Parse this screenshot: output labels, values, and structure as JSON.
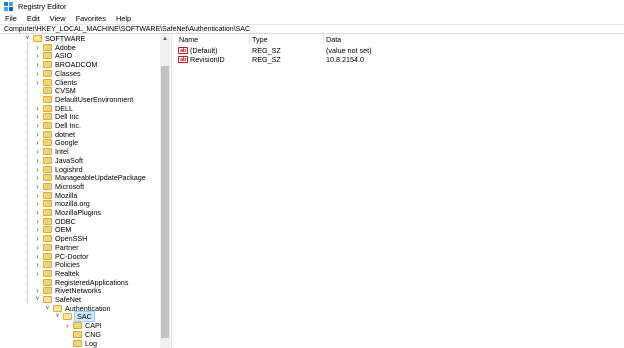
{
  "window": {
    "title": "Registry Editor",
    "icon": "registry-icon"
  },
  "menu": [
    "File",
    "Edit",
    "View",
    "Favorites",
    "Help"
  ],
  "address": "Computer\\HKEY_LOCAL_MACHINE\\SOFTWARE\\SafeNet\\Authentication\\SAC",
  "tree": [
    {
      "label": "SOFTWARE",
      "state": "expanded"
    },
    {
      "label": "Adobe",
      "state": "collapsed"
    },
    {
      "label": "ASIO",
      "state": "collapsed"
    },
    {
      "label": "BROADCOM",
      "state": "collapsed"
    },
    {
      "label": "Classes",
      "state": "collapsed"
    },
    {
      "label": "Clients",
      "state": "collapsed"
    },
    {
      "label": "CVSM",
      "state": "leaf"
    },
    {
      "label": "DefaultUserEnvironment",
      "state": "leaf"
    },
    {
      "label": "DELL",
      "state": "collapsed"
    },
    {
      "label": "Dell Inc",
      "state": "collapsed"
    },
    {
      "label": "Dell Inc.",
      "state": "collapsed"
    },
    {
      "label": "dotnet",
      "state": "collapsed"
    },
    {
      "label": "Google",
      "state": "collapsed"
    },
    {
      "label": "Intel",
      "state": "collapsed"
    },
    {
      "label": "JavaSoft",
      "state": "collapsed"
    },
    {
      "label": "Logishrd",
      "state": "collapsed"
    },
    {
      "label": "ManageableUpdatePackage",
      "state": "collapsed"
    },
    {
      "label": "Microsoft",
      "state": "collapsed"
    },
    {
      "label": "Mozilla",
      "state": "collapsed"
    },
    {
      "label": "mozilla.org",
      "state": "collapsed"
    },
    {
      "label": "MozillaPlugins",
      "state": "collapsed"
    },
    {
      "label": "ODBC",
      "state": "collapsed"
    },
    {
      "label": "OEM",
      "state": "collapsed"
    },
    {
      "label": "OpenSSH",
      "state": "collapsed"
    },
    {
      "label": "Partner",
      "state": "collapsed"
    },
    {
      "label": "PC-Doctor",
      "state": "collapsed"
    },
    {
      "label": "Policies",
      "state": "collapsed"
    },
    {
      "label": "Realtek",
      "state": "collapsed"
    },
    {
      "label": "RegisteredApplications",
      "state": "leaf"
    },
    {
      "label": "RivetNetworks",
      "state": "collapsed"
    },
    {
      "label": "SafeNet",
      "state": "expanded"
    },
    {
      "label": "Authentication",
      "state": "expanded"
    },
    {
      "label": "SAC",
      "state": "expanded",
      "selected": true
    },
    {
      "label": "CAPI",
      "state": "collapsed"
    },
    {
      "label": "CNG",
      "state": "leaf"
    },
    {
      "label": "Log",
      "state": "leaf"
    }
  ],
  "values_table": {
    "columns": [
      "Name",
      "Type",
      "Data"
    ],
    "rows": [
      {
        "name": "(Default)",
        "type": "REG_SZ",
        "data": "(value not set)",
        "icon": "string-value-icon"
      },
      {
        "name": "RevisionID",
        "type": "REG_SZ",
        "data": "10.8.2154.0",
        "icon": "string-value-icon"
      }
    ],
    "icon_text": "ab"
  },
  "colors": {
    "folder": "#f3d37a",
    "selection": "#cde8ff",
    "string_icon": "#b22222"
  }
}
